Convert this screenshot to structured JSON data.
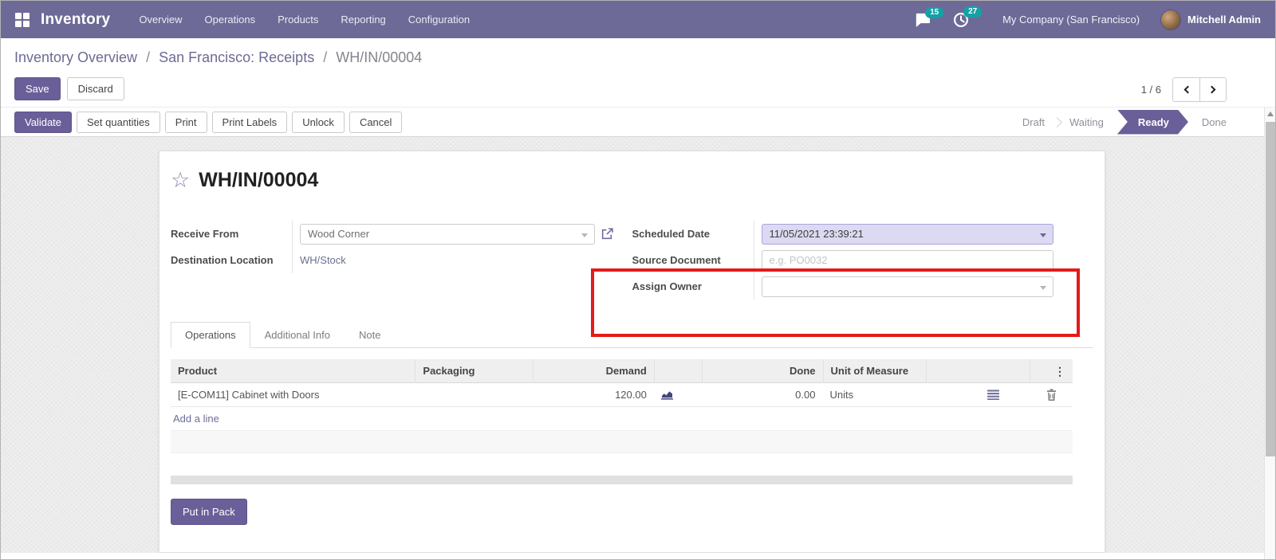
{
  "navbar": {
    "brand": "Inventory",
    "menus": [
      "Overview",
      "Operations",
      "Products",
      "Reporting",
      "Configuration"
    ],
    "messages_count": "15",
    "activities_count": "27",
    "company": "My Company (San Francisco)",
    "user": "Mitchell Admin"
  },
  "breadcrumb": {
    "items": [
      "Inventory Overview",
      "San Francisco: Receipts",
      "WH/IN/00004"
    ]
  },
  "actions": {
    "save": "Save",
    "discard": "Discard",
    "pager": "1 / 6"
  },
  "statusbar": {
    "buttons": [
      "Validate",
      "Set quantities",
      "Print",
      "Print Labels",
      "Unlock",
      "Cancel"
    ],
    "steps": [
      "Draft",
      "Waiting",
      "Ready",
      "Done"
    ],
    "active_step": "Ready"
  },
  "form": {
    "title": "WH/IN/00004",
    "fields": {
      "receive_from": {
        "label": "Receive From",
        "value": "Wood Corner"
      },
      "destination_location": {
        "label": "Destination Location",
        "value": "WH/Stock"
      },
      "scheduled_date": {
        "label": "Scheduled Date",
        "value": "11/05/2021 23:39:21"
      },
      "source_document": {
        "label": "Source Document",
        "placeholder": "e.g. PO0032"
      },
      "assign_owner": {
        "label": "Assign Owner",
        "value": ""
      }
    }
  },
  "tabs": [
    "Operations",
    "Additional Info",
    "Note"
  ],
  "operations_table": {
    "headers": [
      "Product",
      "Packaging",
      "Demand",
      "Done",
      "Unit of Measure"
    ],
    "rows": [
      {
        "product": "[E-COM11] Cabinet with Doors",
        "packaging": "",
        "demand": "120.00",
        "done": "0.00",
        "uom": "Units"
      }
    ],
    "add_line_label": "Add a line"
  },
  "footer": {
    "put_in_pack": "Put in Pack"
  },
  "icons": {
    "star": "☆",
    "kebab": "⋮"
  },
  "colors": {
    "navbar": "#6d6a97",
    "primary_button": "#6b5f99",
    "badge": "#12a2a5",
    "highlight_box": "#e51a1a",
    "link": "#6e6d9b",
    "scheduled_date_bg": "#dcd9f2"
  }
}
